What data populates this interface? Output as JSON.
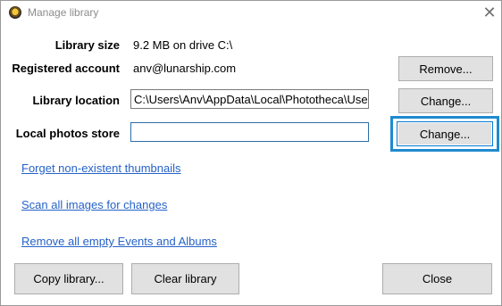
{
  "window": {
    "title": "Manage library",
    "close_glyph": "✕"
  },
  "library_size": {
    "label": "Library size",
    "value": "9.2 MB on drive C:\\"
  },
  "account": {
    "label": "Registered account",
    "value": "anv@lunarship.com",
    "button": "Remove..."
  },
  "location": {
    "label": "Library location",
    "value": "C:\\Users\\Anv\\AppData\\Local\\Phototheca\\Use",
    "button": "Change..."
  },
  "photos_store": {
    "label": "Local photos store",
    "value": "",
    "button": "Change..."
  },
  "links": {
    "forget": "Forget non-existent thumbnails",
    "scan": "Scan all images for changes",
    "remove_empty": "Remove all empty Events and Albums"
  },
  "footer": {
    "copy": "Copy library...",
    "clear": "Clear library",
    "close": "Close"
  },
  "colors": {
    "link": "#2662c8",
    "focus": "#1f8ad0",
    "button_bg": "#e1e1e1"
  },
  "icons": {
    "app": "phototheca-app-icon",
    "close": "close-icon"
  }
}
